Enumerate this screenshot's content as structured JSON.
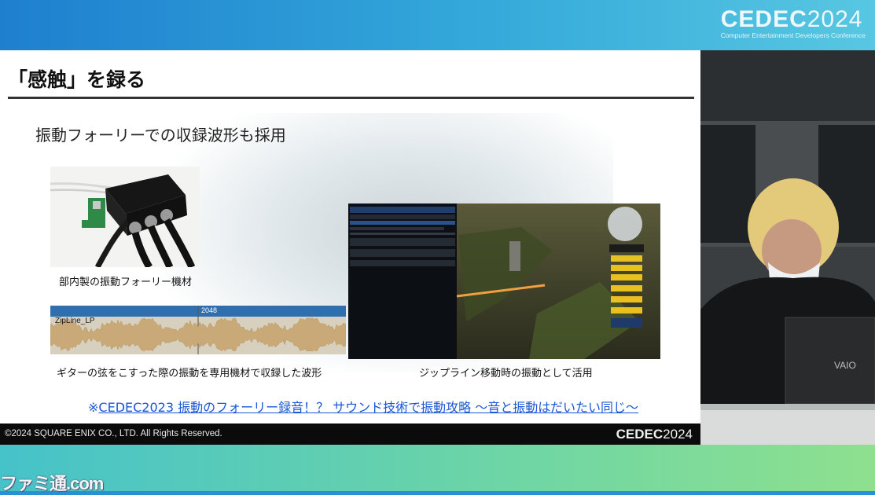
{
  "event_logo": {
    "main_text": "CEDEC",
    "year": "2024",
    "subtitle": "Computer Entertainment Developers Conference"
  },
  "watermark": "ファミ通.com",
  "slide": {
    "title": "「感触」を録る",
    "subtitle": "振動フォーリーでの収録波形も採用",
    "device_caption": "部内製の振動フォーリー機材",
    "waveform": {
      "track_label": "ZipLine_LP",
      "marker": "2048",
      "caption": "ギターの弦をこすった際の振動を専用機材で収録した波形"
    },
    "gameplay_caption": "ジップライン移動時の振動として活用",
    "reference": {
      "prefix": "※",
      "link_text": "CEDEC2023 振動のフォーリー録音！？ サウンド技術で振動攻略 ～音と振動はだいたい同じ～"
    },
    "footer": {
      "copyright": "©2024 SQUARE ENIX CO., LTD. All Rights Reserved.",
      "logo_text": "CEDEC",
      "logo_year": "2024"
    }
  },
  "camera": {
    "laptop_brand": "VAIO"
  },
  "colors": {
    "link": "#1a56d6",
    "waveform_fill": "#c9a977",
    "waveform_bg": "#d7d0bf",
    "waveform_header": "#2f6fb0"
  }
}
